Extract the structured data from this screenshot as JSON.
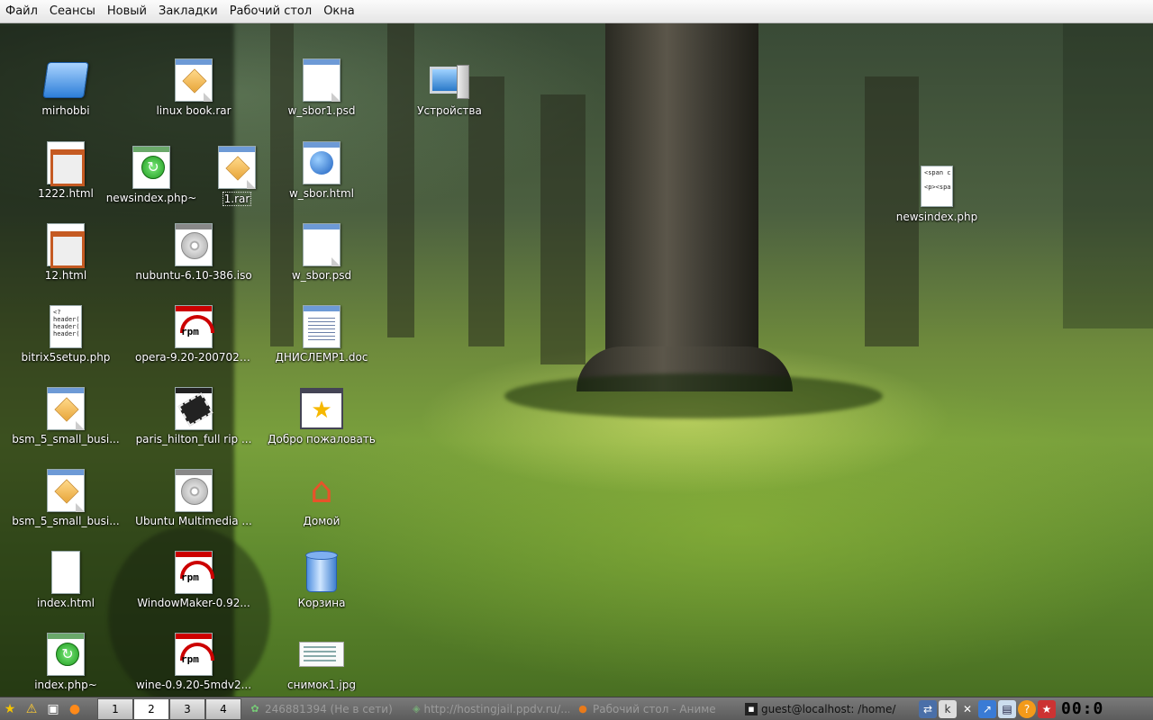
{
  "menu": [
    "Файл",
    "Сеансы",
    "Новый",
    "Закладки",
    "Рабочий стол",
    "Окна"
  ],
  "desktop": {
    "icons": {
      "mirhobbi": "mirhobbi",
      "linux_book": "linux book.rar",
      "w_sbor1_psd": "w_sbor1.psd",
      "devices": "Устройства",
      "html1222": "1222.html",
      "newsindex_tilde": "newsindex.php~",
      "rar1": "1.rar",
      "w_sbor_html": "w_sbor.html",
      "newsindex_php": "newsindex.php",
      "html12": "12.html",
      "nubuntu": "nubuntu-6.10-386.iso",
      "w_sbor_psd": "w_sbor.psd",
      "bitrix": "bitrix5setup.php",
      "opera": "opera-9.20-200702....",
      "dnislemr": "ДНИСЛЕМР1.doc",
      "bsm1": "bsm_5_small_busi...",
      "paris": "paris_hilton_full rip ...",
      "welcome": "Добро пожаловать",
      "bsm2": "bsm_5_small_busi...",
      "ubuntu_mm": "Ubuntu Multimedia ...",
      "home": "Домой",
      "index_html": "index.html",
      "windowmaker": "WindowMaker-0.92...",
      "trash": "Корзина",
      "index_tilde": "index.php~",
      "wine": "wine-0.9.20-5mdv2...",
      "snimok": "снимок1.jpg"
    },
    "icon_code_text": {
      "bitrix": "<?\nheader(\nheader(\nheader(",
      "newsindex": "<span c\n\n<p><spa"
    }
  },
  "taskbar": {
    "workspaces": [
      "1",
      "2",
      "3",
      "4"
    ],
    "active_workspace": "2",
    "tasks": [
      {
        "label": "246881394 (Не в сети)",
        "active": false
      },
      {
        "label": "http://hostingjail.ppdv.ru/...",
        "active": false
      },
      {
        "label": "Рабочий стол - Аниме",
        "active": false
      },
      {
        "label": "guest@localhost: /home/",
        "active": true
      }
    ],
    "clock": "00:0"
  },
  "colors": {
    "menubar": "#ececec",
    "taskbar": "#6a6a6a",
    "rpm_red": "#cc0000",
    "folder_blue": "#2e7fd8"
  }
}
